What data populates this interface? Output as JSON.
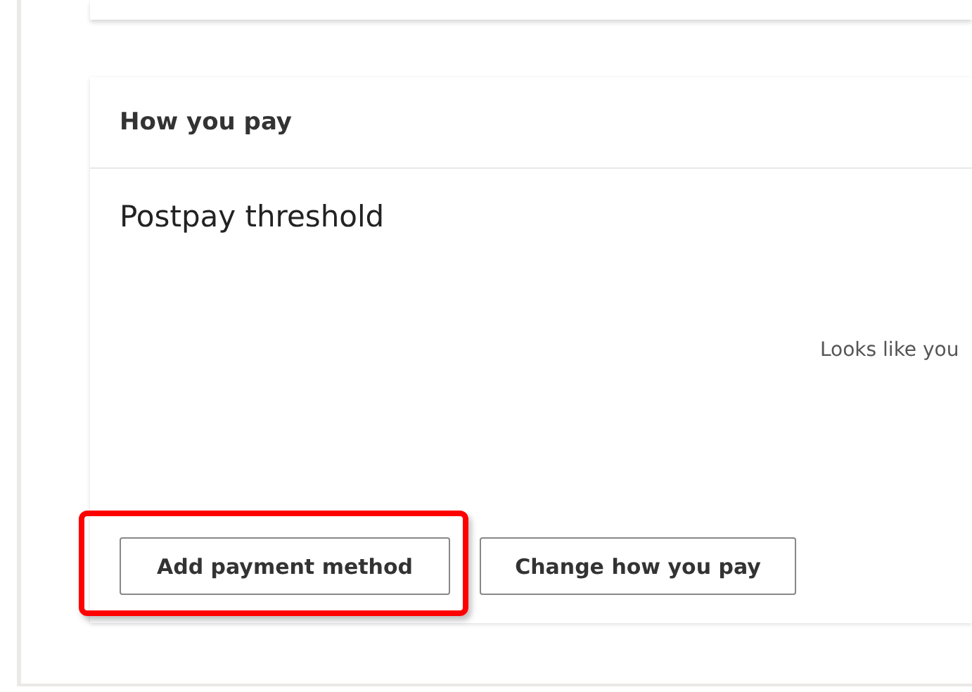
{
  "card": {
    "title": "How you pay",
    "section_title": "Postpay threshold",
    "message": "Looks like you",
    "buttons": [
      {
        "label": "Add payment method",
        "annotation": {
          "kind": "highlight"
        }
      },
      {
        "label": "Change how you pay"
      }
    ]
  }
}
